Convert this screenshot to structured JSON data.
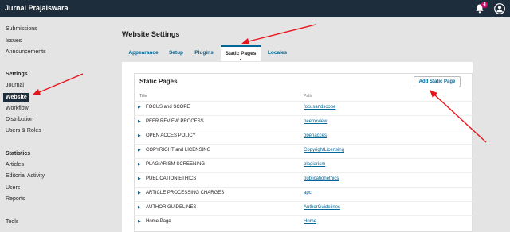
{
  "topbar": {
    "site_title": "Jurnal Prajaiswara",
    "notification_count": "4"
  },
  "sidebar": {
    "items": [
      {
        "label": "Submissions"
      },
      {
        "label": "Issues"
      },
      {
        "label": "Announcements"
      }
    ],
    "settings_heading": "Settings",
    "settings_items": [
      {
        "label": "Journal"
      },
      {
        "label": "Website"
      },
      {
        "label": "Workflow"
      },
      {
        "label": "Distribution"
      },
      {
        "label": "Users & Roles"
      }
    ],
    "statistics_heading": "Statistics",
    "statistics_items": [
      {
        "label": "Articles"
      },
      {
        "label": "Editorial Activity"
      },
      {
        "label": "Users"
      },
      {
        "label": "Reports"
      }
    ],
    "tools_label": "Tools"
  },
  "main": {
    "page_title": "Website Settings",
    "tabs": [
      {
        "label": "Appearance"
      },
      {
        "label": "Setup"
      },
      {
        "label": "Plugins"
      },
      {
        "label": "Static Pages"
      },
      {
        "label": "Locales"
      }
    ],
    "static_pages": {
      "title": "Static Pages",
      "add_button": "Add Static Page",
      "col_title": "Title",
      "col_path": "Path",
      "rows": [
        {
          "title": "FOCUS and SCOPE",
          "path": "focusandscope"
        },
        {
          "title": "PEER REVIEW PROCESS",
          "path": "peerreview"
        },
        {
          "title": "OPEN ACCES POLICY",
          "path": "openacces"
        },
        {
          "title": "COPYRIGHT and LICENSING",
          "path": "CopyrightLicensing"
        },
        {
          "title": "PLAGIARISM SCREENING",
          "path": "plagiarism"
        },
        {
          "title": "PUBLICATION ETHICS",
          "path": "publicationethics"
        },
        {
          "title": "ARTICLE PROCESSING CHARGES",
          "path": "apc"
        },
        {
          "title": "AUTHOR GUIDELINES",
          "path": "AuthorGuidelines"
        },
        {
          "title": "Home Page",
          "path": "Home"
        }
      ]
    }
  },
  "colors": {
    "topbar": "#1e2d3b",
    "accent": "#006798",
    "annotation_arrow": "#e8141c",
    "badge": "#d00a6c"
  }
}
